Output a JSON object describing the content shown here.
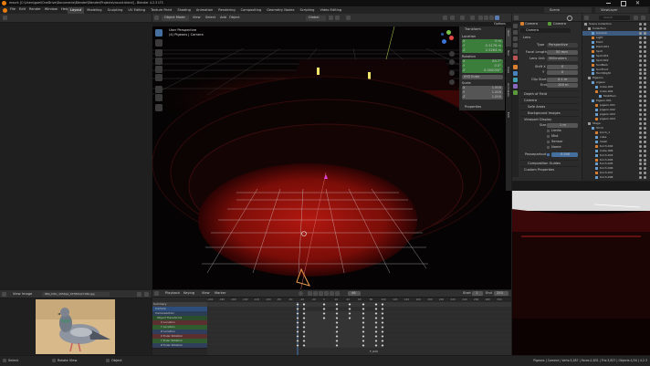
{
  "titlebar": {
    "title": "mount [C:\\Users\\goel\\OneDrive\\Documents\\Blender\\Blender\\Projects\\mount.blend] - Blender 4.2.3 LTS"
  },
  "menu": [
    "File",
    "Edit",
    "Render",
    "Window",
    "Help"
  ],
  "workspaces": [
    "Layout",
    "Modeling",
    "Sculpting",
    "UV Editing",
    "Texture Paint",
    "Shading",
    "Animation",
    "Rendering",
    "Compositing",
    "Geometry Nodes",
    "Scripting",
    "Video Editing"
  ],
  "header_right": {
    "scene": "Scene",
    "view_layer": "ViewLayer"
  },
  "viewport": {
    "mode": "Object Mode",
    "menus": [
      "View",
      "Select",
      "Add",
      "Object"
    ],
    "transform": "Global",
    "overlay_title": "User Perspective",
    "overlay_sub": "(4) Pigeons | Camera",
    "options": "Options",
    "colors": {
      "bg": "#050303",
      "floor": "#b21810",
      "grid": "#d7d7d7"
    }
  },
  "n_panel": {
    "transform_title": "Transform",
    "location_label": "Location",
    "location": [
      {
        "axis": "X",
        "value": "0 m"
      },
      {
        "axis": "Y",
        "value": "-5.5176 m"
      },
      {
        "axis": "Z",
        "value": "2.5264 m"
      }
    ],
    "rotation_label": "Rotation",
    "rotation": [
      {
        "axis": "X",
        "value": "83.7°"
      },
      {
        "axis": "Y",
        "value": "0.0°"
      },
      {
        "axis": "Z",
        "value": "0.000000°"
      }
    ],
    "rotation_mode": "XYZ Euler",
    "scale_label": "Scale",
    "scale": [
      {
        "axis": "X",
        "value": "1.000"
      },
      {
        "axis": "Y",
        "value": "1.000"
      },
      {
        "axis": "Z",
        "value": "1.000"
      }
    ],
    "properties_title": "Properties",
    "tabs": [
      "Item",
      "Tool",
      "View",
      "Animation",
      "Edit"
    ]
  },
  "properties": {
    "tabs_top": [
      "Camera",
      "Camera"
    ],
    "object_name": "Camera",
    "lens_section": "Lens",
    "type_label": "Type",
    "type_value": "Perspective",
    "focal_label": "Focal Length",
    "focal_value": "50 mm",
    "lens_unit_label": "Lens Unit",
    "lens_unit_value": "Millimeters",
    "shift_x_label": "Shift X",
    "shift_x_value": "0",
    "shift_y_label": "Y",
    "shift_y_value": "0",
    "clip_start_label": "Clip Start",
    "clip_start_value": "0.1 m",
    "clip_end_label": "End",
    "clip_end_value": "100 m",
    "sections": [
      "Depth of Field",
      "Camera",
      "Safe Areas",
      "Background Images",
      "Viewport Display"
    ],
    "vp_size_label": "Size",
    "vp_size_value": "1 m",
    "vp_limits": "Limits",
    "vp_mist": "Mist",
    "vp_sensor": "Sensor",
    "vp_name": "Name",
    "passepartout_label": "Passepartout",
    "passepartout_value": "0.500",
    "more_sections": [
      "Composition Guides",
      "Custom Properties"
    ]
  },
  "outliner": {
    "search": "Search",
    "items": [
      "Scene Collection",
      "Collection",
      "Camera",
      "Light",
      "Point",
      "Point.001",
      "Spot",
      "Spot.001",
      "Spot.002",
      "SunBack",
      "SunFront",
      "TorchRight",
      "Pigeons",
      "pigeon",
      "Cube.003",
      "Cube.004",
      "Modifiers",
      "Pigeon.001",
      "pigeon.001",
      "pigeon.002",
      "pigeon.003",
      "pigeon.004",
      "Stage",
      "Torch",
      "torch_1",
      "cube",
      "mesh",
      "torch.002",
      "Cube.006",
      "torch.003",
      "torch.004",
      "torch.005",
      "torch.006",
      "torch.007",
      "torch.008"
    ]
  },
  "image_editor": {
    "menus": [
      "View",
      "Image"
    ],
    "filename": "IMG_DSC_1056px_STH65ok7189.jpg"
  },
  "dopesheet": {
    "menus": [
      "Playback",
      "Keying",
      "View",
      "Marker"
    ],
    "frame_current": "46",
    "start_label": "Start",
    "start_value": "1",
    "end_label": "End",
    "end_value": "250",
    "ruler": [
      "-200",
      "-180",
      "-160",
      "-140",
      "-120",
      "-100",
      "-80",
      "-60",
      "-40",
      "-20",
      "0",
      "20",
      "40",
      "60",
      "80",
      "100",
      "120",
      "140",
      "160",
      "180",
      "200",
      "220",
      "240",
      "260",
      "280",
      "300"
    ],
    "channels": [
      "Summary",
      "Camera",
      "CameraAction",
      "Object Transforms",
      "X Location",
      "Y Location",
      "Z Location",
      "X Euler Rotation",
      "Y Euler Rotation",
      "Z Euler Rotation"
    ],
    "channel_colors": [
      "#3d3d3d",
      "#2d4d7a",
      "#2b3c55",
      "#2b4d2b",
      "#5b2f2f",
      "#2f5b2f",
      "#2f3f5b",
      "#5b2f2f",
      "#2f5b2f",
      "#2f3f5b"
    ],
    "marker": "F_020"
  },
  "statusbar": {
    "items": [
      "Select",
      "Rotate View",
      "Object"
    ],
    "right": "Pigeons | Camera | Verts:5,287 | Faces:2,831 | Tris:3,827 | Objects:1/34 | 4.2.3"
  },
  "render_preview": {
    "colors": {
      "top": "#e9e9e9",
      "bottom": "#1a0505",
      "floor": "#8a1010"
    }
  }
}
